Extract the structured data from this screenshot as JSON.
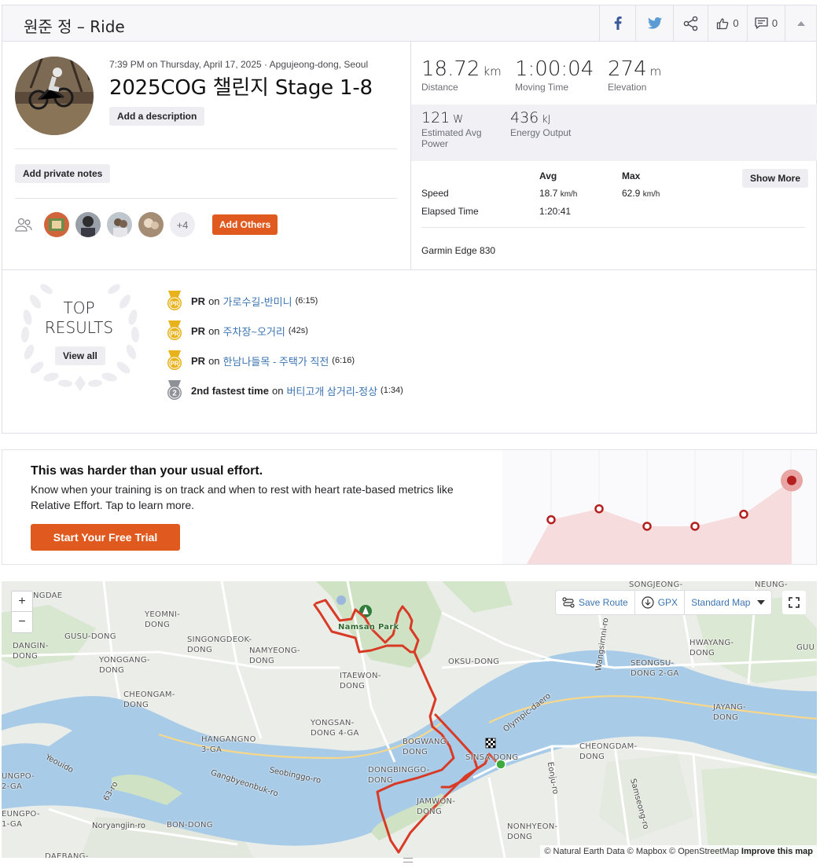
{
  "header": {
    "title": "원준 정 – Ride",
    "kudos_count": "0",
    "comments_count": "0"
  },
  "activity": {
    "meta": "7:39 PM on Thursday, April 17, 2025 · Apgujeong-dong, Seoul",
    "name": "2025COG 챌린지 Stage 1-8",
    "add_description": "Add a description",
    "add_private_notes": "Add private notes",
    "others_count": "+4",
    "add_others": "Add Others"
  },
  "stats": {
    "distance": {
      "value": "18.72",
      "unit": "km",
      "label": "Distance"
    },
    "moving_time": {
      "value": "1:00:04",
      "label": "Moving Time"
    },
    "elevation": {
      "value": "274",
      "unit": "m",
      "label": "Elevation"
    },
    "power": {
      "value": "121",
      "unit": "W",
      "label_1": "Estimated Avg",
      "label_2": "Power"
    },
    "energy": {
      "value": "436",
      "unit": "kJ",
      "label": "Energy Output"
    }
  },
  "more_stats": {
    "col_avg": "Avg",
    "col_max": "Max",
    "show_more": "Show More",
    "rows": [
      {
        "label": "Speed",
        "avg": "18.7",
        "avg_unit": "km/h",
        "max": "62.9",
        "max_unit": "km/h"
      },
      {
        "label": "Elapsed Time",
        "avg": "1:20:41",
        "max": ""
      }
    ],
    "device": "Garmin Edge 830"
  },
  "top_results": {
    "title_1": "TOP",
    "title_2": "RESULTS",
    "view_all": "View all",
    "items": [
      {
        "badge": "PR",
        "prefix": "PR",
        "on": "on",
        "segment": "가로수길-반미니",
        "time": "(6:15)"
      },
      {
        "badge": "PR",
        "prefix": "PR",
        "on": "on",
        "segment": "주차장~오거리",
        "time": "(42s)"
      },
      {
        "badge": "PR",
        "prefix": "PR",
        "on": "on",
        "segment": "한남나들목 - 주택가 직전",
        "time": "(6:16)"
      },
      {
        "badge": "2",
        "prefix": "2nd fastest time",
        "on": "on",
        "segment": "버티고개 삼거리-정상",
        "time": "(1:34)"
      }
    ]
  },
  "promo": {
    "title": "This was harder than your usual effort.",
    "body": "Know when your training is on track and when to rest with heart rate-based metrics like Relative Effort. Tap to learn more.",
    "cta": "Start Your Free Trial"
  },
  "effort_chart": {
    "type": "line",
    "values": [
      42,
      52,
      36,
      36,
      47,
      78
    ],
    "highlight_index": 5
  },
  "map": {
    "save_route": "Save Route",
    "gpx": "GPX",
    "map_style": "Standard Map",
    "attribution_1": "© Natural Earth Data",
    "attribution_2": "© Mapbox",
    "attribution_3": "© OpenStreetMap",
    "attribution_4": "Improve this map",
    "park": "Namsan Park",
    "labels": [
      {
        "text": "NGDAE"
      },
      {
        "text": "YEOMNI-\nDONG"
      },
      {
        "text": "SINGONGDEOK-\nDONG"
      },
      {
        "text": "GUSU-DONG"
      },
      {
        "text": "DANGIN-\nDONG"
      },
      {
        "text": "YONGGANG-\nDONG"
      },
      {
        "text": "NAMYEONG-\nDONG"
      },
      {
        "text": "OKSU-DONG"
      },
      {
        "text": "ITAEWON-\nDONG"
      },
      {
        "text": "CHEONGAM-\nDONG"
      },
      {
        "text": "YONGSAN-\nDONG 4-GA"
      },
      {
        "text": "HANGANGNO\n3-GA"
      },
      {
        "text": "BOGWANG-\nDONG"
      },
      {
        "text": "DONGBINGGO-\nDONG"
      },
      {
        "text": "JAMWON-\nDONG"
      },
      {
        "text": "SINSA-DONG"
      },
      {
        "text": "CHEONGDAM-\nDONG"
      },
      {
        "text": "NONHYEON-\nDONG"
      },
      {
        "text": "BON-DONG"
      },
      {
        "text": "JAYANG-\nDONG"
      },
      {
        "text": "HWAYANG-\nDONG"
      },
      {
        "text": "SEONGSU-\nDONG 2-GA"
      },
      {
        "text": "SONGJEONG-"
      },
      {
        "text": "NEUNG-"
      },
      {
        "text": "GUU"
      },
      {
        "text": "UNGPO-\n2-GA"
      },
      {
        "text": "EUNGPO-\n1-GA"
      },
      {
        "text": "DAEBANG-"
      }
    ],
    "roads": [
      {
        "text": "Olympic-daero"
      },
      {
        "text": "Wangsimni-ro"
      },
      {
        "text": "Seobinggo-ro"
      },
      {
        "text": "Gangbyeonbuk-ro"
      },
      {
        "text": "Yeouido"
      },
      {
        "text": "Noryangjin-ro"
      },
      {
        "text": "63-ro"
      },
      {
        "text": "Eonju-ro"
      },
      {
        "text": "Samseong-ro"
      }
    ]
  }
}
